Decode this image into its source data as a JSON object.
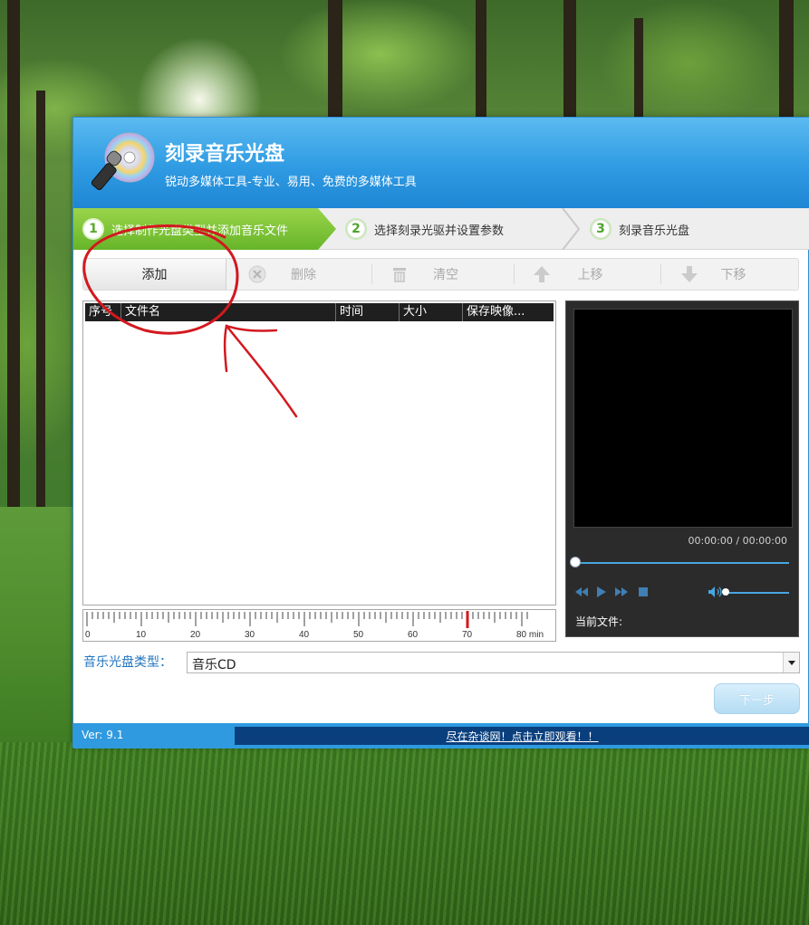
{
  "app": {
    "title": "刻录音乐光盘",
    "subtitle": "锐动多媒体工具-专业、易用、免费的多媒体工具"
  },
  "steps": [
    {
      "num": "1",
      "label": "选择制作光盘类型并添加音乐文件"
    },
    {
      "num": "2",
      "label": "选择刻录光驱并设置参数"
    },
    {
      "num": "3",
      "label": "刻录音乐光盘"
    }
  ],
  "toolbar": {
    "add_label": "添加",
    "delete_label": "删除",
    "clear_label": "清空",
    "up_label": "上移",
    "down_label": "下移"
  },
  "table": {
    "columns": [
      "序号",
      "文件名",
      "时间",
      "大小",
      "保存映像..."
    ]
  },
  "ruler": {
    "labels": [
      "0",
      "10",
      "20",
      "30",
      "40",
      "50",
      "60",
      "70",
      "80 min"
    ],
    "marker_value": 70,
    "max_value": 80
  },
  "player": {
    "time": "00:00:00 / 00:00:00",
    "current_file_label": "当前文件:"
  },
  "disc_type": {
    "label": "音乐光盘类型：",
    "value": "音乐CD"
  },
  "next_label": "下一步",
  "status": {
    "version": "Ver: 9.1",
    "promo": "尽在杂谈网！点击立即观看！！"
  },
  "colors": {
    "header_blue": "#2f9be3",
    "step_green": "#66b52a",
    "label_blue": "#2276c0",
    "annotation_red": "#d2191f"
  }
}
